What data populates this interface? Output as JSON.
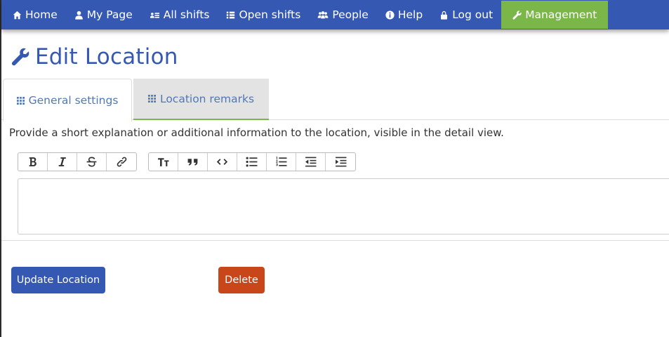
{
  "nav": {
    "items": [
      {
        "label": "Home",
        "icon": "home-icon"
      },
      {
        "label": "My Page",
        "icon": "user-icon"
      },
      {
        "label": "All shifts",
        "icon": "shifts-icon"
      },
      {
        "label": "Open shifts",
        "icon": "list-icon"
      },
      {
        "label": "People",
        "icon": "people-icon"
      },
      {
        "label": "Help",
        "icon": "info-icon"
      },
      {
        "label": "Log out",
        "icon": "lock-icon"
      },
      {
        "label": "Management",
        "icon": "wrench-icon",
        "active": true
      }
    ],
    "bg_color": "#3559b3",
    "active_color": "#7ab648"
  },
  "page": {
    "title": "Edit Location"
  },
  "tabs": [
    {
      "label": "General settings",
      "icon": "grid-icon",
      "active": false
    },
    {
      "label": "Location remarks",
      "icon": "grid-icon",
      "active": true
    }
  ],
  "remarks": {
    "description": "Provide a short explanation or additional information to the location, visible in the detail view.",
    "editor_value": "",
    "toolbar_group_1": [
      "bold",
      "italic",
      "strikethrough",
      "link"
    ],
    "toolbar_group_2": [
      "heading",
      "quote",
      "code",
      "bullet-list",
      "numbered-list",
      "outdent",
      "indent"
    ]
  },
  "actions": {
    "update_label": "Update Location",
    "delete_label": "Delete",
    "update_color": "#3559b3",
    "delete_color": "#c9461a"
  }
}
